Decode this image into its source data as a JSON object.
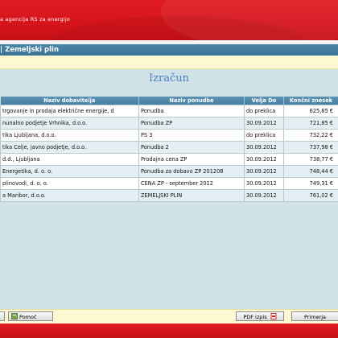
{
  "header": {
    "agency": "a agencija RS za energijo"
  },
  "pagebar": {
    "title": "| Zemeljski plin"
  },
  "title": "Izračun",
  "table": {
    "headers": [
      "Naziv dobavitelja",
      "Naziv ponudbe",
      "Velja Do",
      "Končni znesek"
    ],
    "rows": [
      {
        "dobavitelj": "trgovanje in prodaja električne energije, d",
        "ponudba": "Ponudba",
        "velja": "do preklica",
        "znesek": "625,85 €"
      },
      {
        "dobavitelj": "nunalno podjetje Vrhnika, d.o.o.",
        "ponudba": "Ponudba ZP",
        "velja": "30.09.2012",
        "znesek": "721,85 €"
      },
      {
        "dobavitelj": "tika Ljubljana, d.o.o.",
        "ponudba": "PS 3",
        "velja": "do preklica",
        "znesek": "732,22 €"
      },
      {
        "dobavitelj": "tika Celje, javno podjetje, d.o.o.",
        "ponudba": "Ponudba 2",
        "velja": "30.09.2012",
        "znesek": "737,98 €"
      },
      {
        "dobavitelj": "d.d., Ljubljana",
        "ponudba": "Prodajna cena ZP",
        "velja": "30.09.2012",
        "znesek": "738,77 €"
      },
      {
        "dobavitelj": "Energetika, d. o. o.",
        "ponudba": "Ponudba za dobavo ZP 201208",
        "velja": "30.09.2012",
        "znesek": "748,44 €"
      },
      {
        "dobavitelj": "plinovodi, d. o. o.",
        "ponudba": "CENA ZP - september 2012",
        "velja": "30.09.2012",
        "znesek": "749,31 €"
      },
      {
        "dobavitelj": "a Maribor, d.o.o.",
        "ponudba": "ZEMELJSKI PLIN",
        "velja": "30.09.2012",
        "znesek": "761,02 €"
      }
    ]
  },
  "buttons": {
    "help": "Pomoč",
    "pdf": "PDF izpis",
    "compare": "Primerja"
  },
  "icons": {
    "help": "help-book-icon",
    "pdf": "pdf-icon"
  },
  "colors": {
    "brand_red": "#d5141b",
    "bar_blue": "#3f7a9c",
    "title_blue": "#4a7fc1"
  }
}
